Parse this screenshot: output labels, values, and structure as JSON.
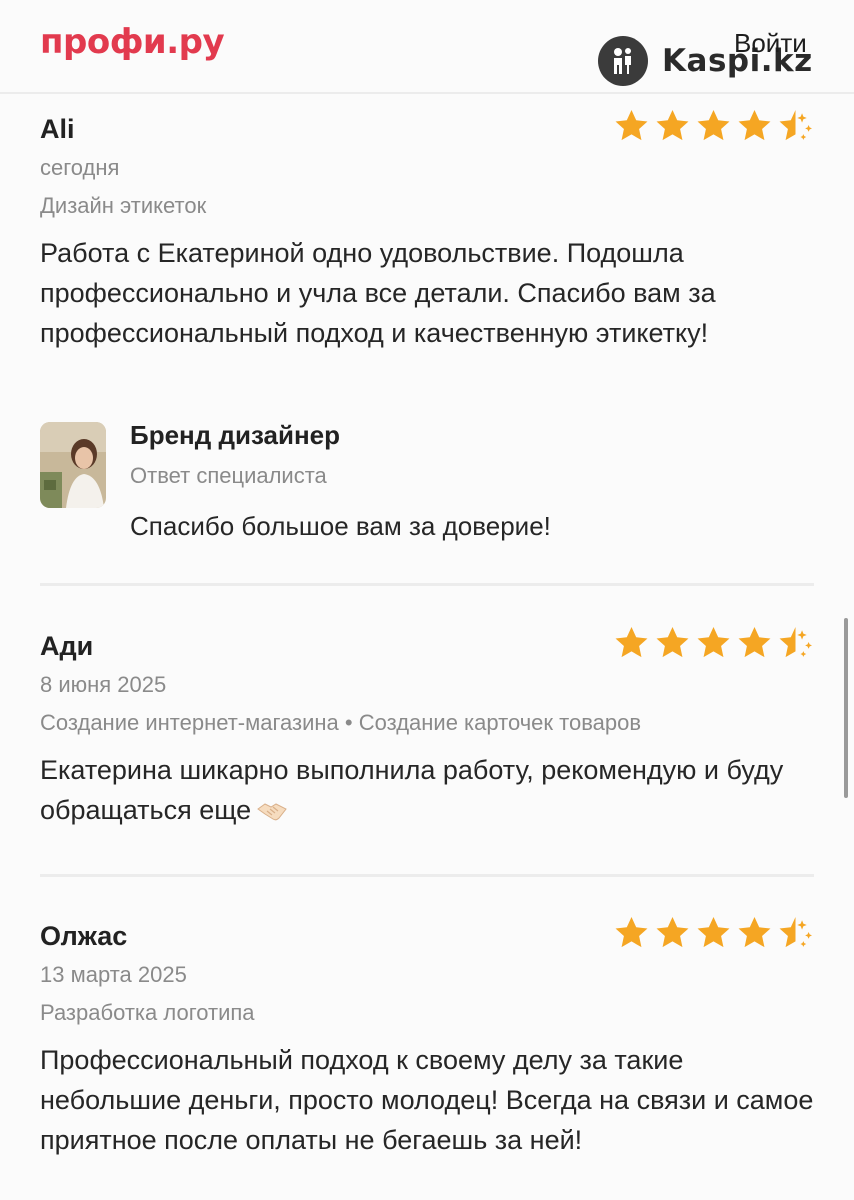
{
  "header": {
    "logo": "профи.ру",
    "login_label": "Войти",
    "watermark_text": "Kaspi.kz"
  },
  "reviews": [
    {
      "author": "Ali",
      "date": "сегодня",
      "service": "Дизайн этикеток",
      "rating": 4.5,
      "text": "Работа с Екатериной одно удовольствие. Подошла профессионально и учла все детали. Спасибо вам за профессиональный подход и качественную этикетку!",
      "reply": {
        "name": "Бренд дизайнер",
        "role": "Ответ специалиста",
        "text": "Спасибо большое вам за доверие!"
      }
    },
    {
      "author": "Ади",
      "date": "8 июня 2025",
      "service": "Создание интернет-магазина • Создание карточек товаров",
      "rating": 4.5,
      "text": "Екатерина шикарно выполнила работу, рекомендую и буду обращаться еще",
      "emoji": "handshake"
    },
    {
      "author": "Олжас",
      "date": "13 марта 2025",
      "service": "Разработка логотипа",
      "rating": 4.5,
      "text": "Профессиональный подход к своему делу за такие небольшие деньги, просто молодец! Всегда на связи и самое приятное после оплаты не бегаешь за ней!"
    }
  ],
  "colors": {
    "brand": "#e23a4e",
    "star": "#f5a623",
    "muted_text": "#8a8a8a"
  }
}
